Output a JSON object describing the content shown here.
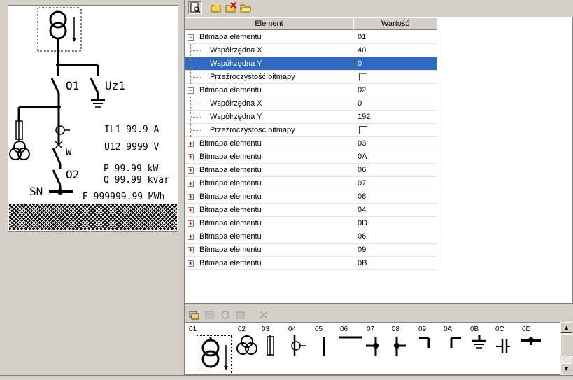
{
  "preview": {
    "labels": {
      "o1": "O1",
      "uz1": "Uz1",
      "il1": "IL1  99.9 A",
      "u12": "U12  9999 V",
      "w": "W",
      "o2": "O2",
      "p": "P 99.99 kW",
      "q": "Q 99.99 kvar",
      "sn": "SN",
      "e": "E 999999.99 MWh"
    }
  },
  "toolbar": {
    "icons": [
      "preview-icon",
      "new-icon",
      "delete-icon",
      "open-folder-icon"
    ]
  },
  "grid": {
    "headers": {
      "element": "Element",
      "value": "Wartość"
    },
    "rows": [
      {
        "label": "Bitmapa elementu",
        "value": "01",
        "level": 0,
        "expander": "minus"
      },
      {
        "label": "Współrzędna X",
        "value": "40",
        "level": 1
      },
      {
        "label": "Współrzędna Y",
        "value": "0",
        "level": 1,
        "selected": true
      },
      {
        "label": "Przeźroczystość bitmapy",
        "value": "",
        "level": 1,
        "checkbox": true
      },
      {
        "label": "Bitmapa elementu",
        "value": "02",
        "level": 0,
        "expander": "minus"
      },
      {
        "label": "Współrzędna X",
        "value": "0",
        "level": 1
      },
      {
        "label": "Współrzędna Y",
        "value": "192",
        "level": 1
      },
      {
        "label": "Przeźroczystość bitmapy",
        "value": "",
        "level": 1,
        "checkbox": true
      },
      {
        "label": "Bitmapa elementu",
        "value": "03",
        "level": 0,
        "expander": "plus"
      },
      {
        "label": "Bitmapa elementu",
        "value": "0A",
        "level": 0,
        "expander": "plus"
      },
      {
        "label": "Bitmapa elementu",
        "value": "06",
        "level": 0,
        "expander": "plus"
      },
      {
        "label": "Bitmapa elementu",
        "value": "07",
        "level": 0,
        "expander": "plus"
      },
      {
        "label": "Bitmapa elementu",
        "value": "08",
        "level": 0,
        "expander": "plus"
      },
      {
        "label": "Bitmapa elementu",
        "value": "04",
        "level": 0,
        "expander": "plus"
      },
      {
        "label": "Bitmapa elementu",
        "value": "0D",
        "level": 0,
        "expander": "plus"
      },
      {
        "label": "Bitmapa elementu",
        "value": "06",
        "level": 0,
        "expander": "plus"
      },
      {
        "label": "Bitmapa elementu",
        "value": "09",
        "level": 0,
        "expander": "plus"
      },
      {
        "label": "Bitmapa elementu",
        "value": "0B",
        "level": 0,
        "expander": "plus"
      }
    ]
  },
  "bottom_toolbar": {
    "icons": [
      "add-layer-icon",
      "copy-icon",
      "refresh-icon",
      "paste-icon",
      "close-icon"
    ]
  },
  "palette": {
    "items": [
      {
        "label": "01",
        "icon": "transformer-arrow-icon",
        "selected": true
      },
      {
        "label": "02",
        "icon": "three-winding-transformer-icon"
      },
      {
        "label": "03",
        "icon": "fuse-icon"
      },
      {
        "label": "04",
        "icon": "disconnector-circle-icon"
      },
      {
        "label": "05",
        "icon": "vertical-line-icon"
      },
      {
        "label": "06",
        "icon": "horizontal-line-icon"
      },
      {
        "label": "07",
        "icon": "t-junction-icon"
      },
      {
        "label": "08",
        "icon": "cross-junction-icon"
      },
      {
        "label": "09",
        "icon": "corner-icon"
      },
      {
        "label": "0A",
        "icon": "corner-left-icon"
      },
      {
        "label": "0B",
        "icon": "ground-icon"
      },
      {
        "label": "0C",
        "icon": "capacitor-icon"
      },
      {
        "label": "0D",
        "icon": "busbar-icon"
      }
    ]
  }
}
